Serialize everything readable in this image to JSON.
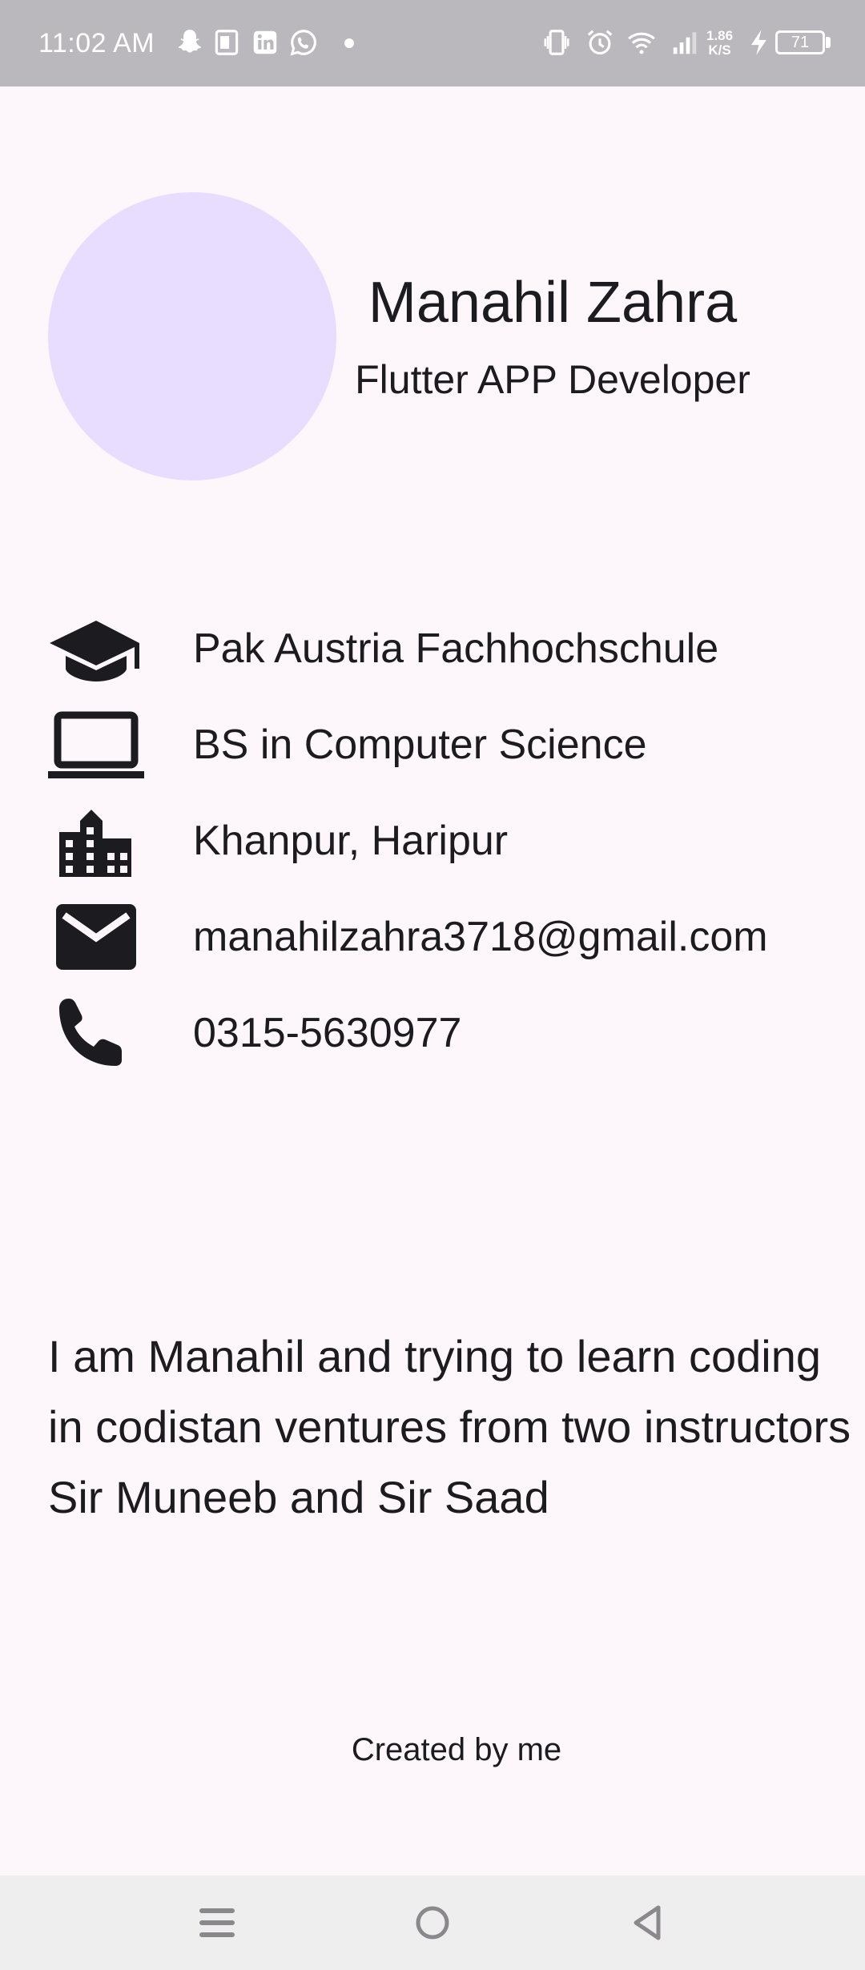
{
  "status_bar": {
    "time": "11:02 AM",
    "network_speed_value": "1.86",
    "network_speed_unit": "K/S",
    "battery_level": "71"
  },
  "profile": {
    "name": "Manahil Zahra",
    "title": "Flutter APP Developer"
  },
  "info": [
    {
      "icon": "school-icon",
      "text": "Pak Austria Fachhochschule"
    },
    {
      "icon": "laptop-icon",
      "text": "BS in Computer Science"
    },
    {
      "icon": "location-city-icon",
      "text": "Khanpur, Haripur"
    },
    {
      "icon": "email-icon",
      "text": "manahilzahra3718@gmail.com"
    },
    {
      "icon": "phone-icon",
      "text": "0315-5630977"
    }
  ],
  "bio": "I am Manahil and trying to learn coding in codistan ventures from two instructors Sir Muneeb and Sir Saad",
  "footer": "Created by me",
  "colors": {
    "background": "#fdf7fc",
    "avatar": "#e9ddff",
    "status_bar": "#bab7bd",
    "nav_bar": "#efeeef",
    "text": "#1c1b1f"
  }
}
